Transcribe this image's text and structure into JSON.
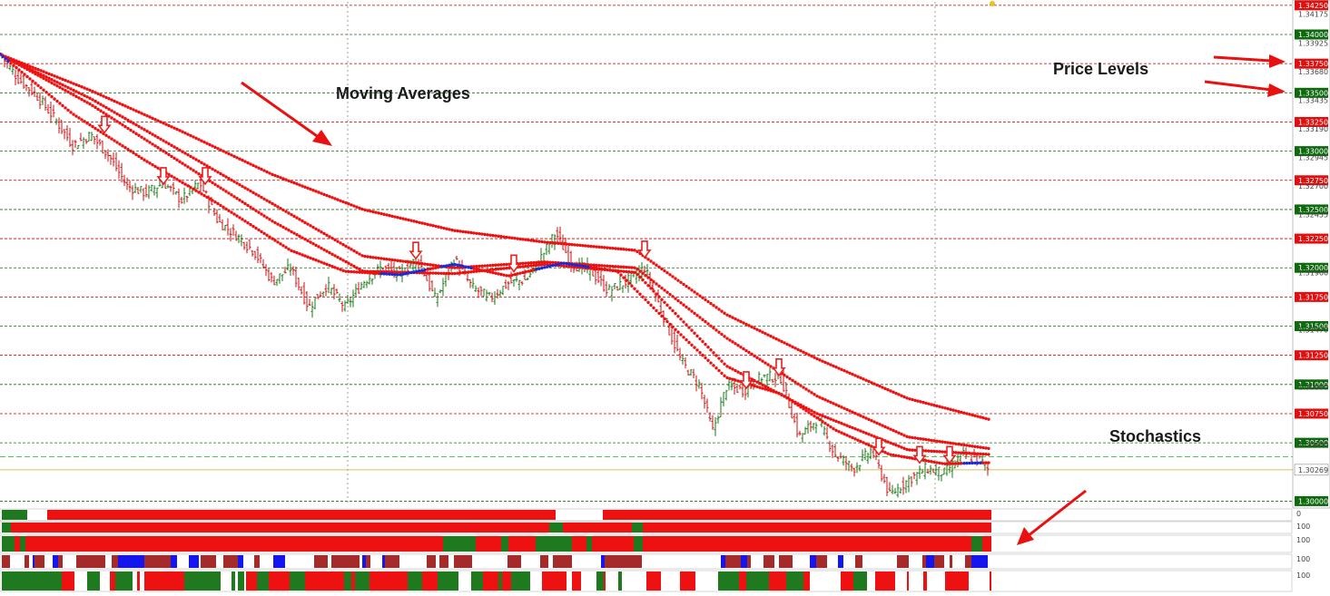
{
  "annotations": {
    "moving_averages": "Moving Averages",
    "price_levels": "Price Levels",
    "stochastics": "Stochastics"
  },
  "price_axis": {
    "min": 1.2998,
    "max": 1.3428,
    "current_price": "1.30269",
    "secondary_ticks": [
      "1.34175",
      "1.33925",
      "1.33680",
      "1.33435",
      "1.33190",
      "1.32945",
      "1.32700",
      "1.32455",
      "1.31960",
      "1.31470",
      "1.30980",
      "1.30490"
    ]
  },
  "level_markers": [
    {
      "label": "1.34250",
      "value": 1.3425,
      "kind": "red"
    },
    {
      "label": "1.34000",
      "value": 1.34,
      "kind": "green"
    },
    {
      "label": "1.33750",
      "value": 1.3375,
      "kind": "red"
    },
    {
      "label": "1.33500",
      "value": 1.335,
      "kind": "green"
    },
    {
      "label": "1.33250",
      "value": 1.3325,
      "kind": "red"
    },
    {
      "label": "1.33000",
      "value": 1.33,
      "kind": "green"
    },
    {
      "label": "1.32750",
      "value": 1.3275,
      "kind": "red"
    },
    {
      "label": "1.32500",
      "value": 1.325,
      "kind": "green"
    },
    {
      "label": "1.32250",
      "value": 1.3225,
      "kind": "red"
    },
    {
      "label": "1.32000",
      "value": 1.32,
      "kind": "green"
    },
    {
      "label": "1.31750",
      "value": 1.3175,
      "kind": "red"
    },
    {
      "label": "1.31500",
      "value": 1.315,
      "kind": "green"
    },
    {
      "label": "1.31250",
      "value": 1.3125,
      "kind": "red"
    },
    {
      "label": "1.31000",
      "value": 1.31,
      "kind": "green"
    },
    {
      "label": "1.30750",
      "value": 1.3075,
      "kind": "red"
    },
    {
      "label": "1.30500",
      "value": 1.305,
      "kind": "green"
    },
    {
      "label": "1.30000",
      "value": 1.3,
      "kind": "green"
    }
  ],
  "indicator_panels": [
    {
      "top_label": "0"
    },
    {
      "top_label": "100"
    },
    {
      "top_label": "100"
    },
    {
      "top_label": "100"
    },
    {
      "top_label": "100"
    }
  ],
  "colors": {
    "bull_candle": "#1a7a1a",
    "bear_candle": "#cc1010",
    "ma": "#ee1111",
    "ma_blue": "#1a2bd8",
    "arrow": "#e82020",
    "grid_red": "#c00000",
    "grid_green": "#1f6b1f",
    "level_red": "#e01010",
    "level_green": "#0f6a0f"
  },
  "chart_data": {
    "type": "candlestick",
    "timeframe": "",
    "close_path": [
      [
        0,
        1.3383
      ],
      [
        20,
        1.3362
      ],
      [
        40,
        1.3348
      ],
      [
        60,
        1.3328
      ],
      [
        80,
        1.3305
      ],
      [
        100,
        1.3314
      ],
      [
        120,
        1.3296
      ],
      [
        140,
        1.327
      ],
      [
        160,
        1.3264
      ],
      [
        180,
        1.3273
      ],
      [
        200,
        1.3258
      ],
      [
        220,
        1.3273
      ],
      [
        240,
        1.324
      ],
      [
        260,
        1.3228
      ],
      [
        280,
        1.3214
      ],
      [
        300,
        1.3188
      ],
      [
        320,
        1.32
      ],
      [
        340,
        1.3166
      ],
      [
        360,
        1.3185
      ],
      [
        380,
        1.3166
      ],
      [
        400,
        1.3188
      ],
      [
        420,
        1.32
      ],
      [
        440,
        1.3195
      ],
      [
        460,
        1.3208
      ],
      [
        480,
        1.3172
      ],
      [
        500,
        1.3208
      ],
      [
        520,
        1.3183
      ],
      [
        540,
        1.3174
      ],
      [
        560,
        1.3187
      ],
      [
        580,
        1.319
      ],
      [
        600,
        1.3214
      ],
      [
        612,
        1.323
      ],
      [
        630,
        1.3203
      ],
      [
        650,
        1.3198
      ],
      [
        670,
        1.318
      ],
      [
        690,
        1.3188
      ],
      [
        710,
        1.32
      ],
      [
        730,
        1.316
      ],
      [
        750,
        1.312
      ],
      [
        770,
        1.31
      ],
      [
        785,
        1.306
      ],
      [
        800,
        1.3098
      ],
      [
        820,
        1.3095
      ],
      [
        840,
        1.3107
      ],
      [
        860,
        1.3106
      ],
      [
        880,
        1.3055
      ],
      [
        900,
        1.307
      ],
      [
        920,
        1.304
      ],
      [
        940,
        1.3028
      ],
      [
        960,
        1.3044
      ],
      [
        980,
        1.3005
      ],
      [
        1000,
        1.3018
      ],
      [
        1020,
        1.3028
      ],
      [
        1040,
        1.3024
      ],
      [
        1060,
        1.304
      ],
      [
        1080,
        1.3035
      ],
      [
        1088,
        1.3027
      ]
    ],
    "moving_averages": [
      {
        "points": [
          [
            0,
            1.3383
          ],
          [
            100,
            1.3352
          ],
          [
            200,
            1.3317
          ],
          [
            300,
            1.328
          ],
          [
            400,
            1.325
          ],
          [
            500,
            1.3232
          ],
          [
            600,
            1.3222
          ],
          [
            700,
            1.3215
          ],
          [
            800,
            1.316
          ],
          [
            900,
            1.3122
          ],
          [
            1000,
            1.3088
          ],
          [
            1090,
            1.307
          ]
        ]
      },
      {
        "points": [
          [
            0,
            1.3383
          ],
          [
            100,
            1.3345
          ],
          [
            200,
            1.33
          ],
          [
            300,
            1.3255
          ],
          [
            400,
            1.321
          ],
          [
            500,
            1.32
          ],
          [
            600,
            1.3205
          ],
          [
            700,
            1.32
          ],
          [
            800,
            1.314
          ],
          [
            900,
            1.309
          ],
          [
            1000,
            1.3055
          ],
          [
            1090,
            1.3045
          ]
        ]
      },
      {
        "points": [
          [
            0,
            1.3383
          ],
          [
            100,
            1.334
          ],
          [
            200,
            1.329
          ],
          [
            300,
            1.324
          ],
          [
            400,
            1.3197
          ],
          [
            500,
            1.3195
          ],
          [
            600,
            1.3203
          ],
          [
            700,
            1.3196
          ],
          [
            800,
            1.3116
          ],
          [
            900,
            1.3075
          ],
          [
            1000,
            1.3044
          ],
          [
            1090,
            1.304
          ]
        ]
      },
      {
        "points": [
          [
            0,
            1.3383
          ],
          [
            80,
            1.3332
          ],
          [
            160,
            1.3292
          ],
          [
            240,
            1.3255
          ],
          [
            320,
            1.3215
          ],
          [
            380,
            1.3197
          ],
          [
            440,
            1.3194
          ],
          [
            500,
            1.3203
          ],
          [
            560,
            1.3193
          ],
          [
            620,
            1.3204
          ],
          [
            680,
            1.3197
          ],
          [
            740,
            1.315
          ],
          [
            800,
            1.3106
          ],
          [
            860,
            1.3092
          ],
          [
            920,
            1.3061
          ],
          [
            980,
            1.304
          ],
          [
            1040,
            1.3032
          ],
          [
            1090,
            1.3033
          ]
        ],
        "blue_ranges": [
          [
            0,
            10
          ],
          [
            420,
            470
          ],
          [
            485,
            520
          ],
          [
            590,
            650
          ],
          [
            1060,
            1080
          ]
        ]
      }
    ],
    "sell_arrows": [
      [
        115,
        1.3322
      ],
      [
        180,
        1.3278
      ],
      [
        226,
        1.3278
      ],
      [
        458,
        1.3214
      ],
      [
        566,
        1.3203
      ],
      [
        710,
        1.3215
      ],
      [
        822,
        1.3103
      ],
      [
        858,
        1.3114
      ],
      [
        968,
        1.3046
      ],
      [
        1013,
        1.3039
      ],
      [
        1046,
        1.3039
      ]
    ],
    "markers": [
      [
        1093,
        1.3428
      ]
    ]
  }
}
